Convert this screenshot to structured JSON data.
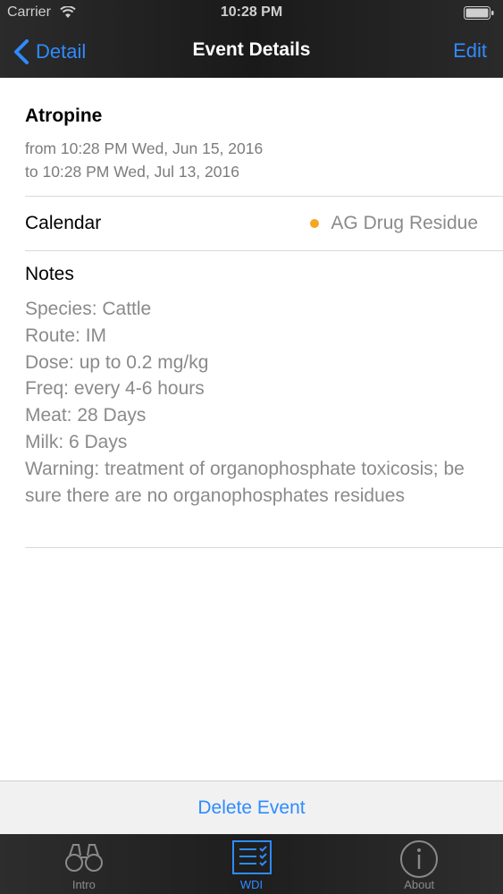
{
  "status_bar": {
    "carrier": "Carrier",
    "time": "10:28 PM"
  },
  "nav": {
    "back_label": "Detail",
    "title": "Event Details",
    "edit_label": "Edit"
  },
  "event": {
    "title": "Atropine",
    "from": "from 10:28 PM Wed, Jun 15, 2016",
    "to": "to 10:28 PM Wed, Jul 13, 2016"
  },
  "calendar": {
    "label": "Calendar",
    "value": "AG Drug Residue",
    "dot_color": "#f5a623"
  },
  "notes": {
    "label": "Notes",
    "body": "Species: Cattle\nRoute:   IM\nDose:    up to 0.2 mg/kg\nFreq:     every 4-6 hours\nMeat:    28 Days\nMilk:     6 Days\nWarning:  treatment of organophosphate toxicosis; be sure there are no organophosphates residues"
  },
  "toolbar": {
    "delete_label": "Delete Event"
  },
  "tabs": [
    {
      "label": "Intro",
      "icon": "binoculars-icon"
    },
    {
      "label": "WDI",
      "icon": "checklist-icon",
      "active": true
    },
    {
      "label": "About",
      "icon": "info-icon"
    }
  ],
  "colors": {
    "accent": "#2f8bff",
    "bar_dark": "#1e1e1e"
  }
}
